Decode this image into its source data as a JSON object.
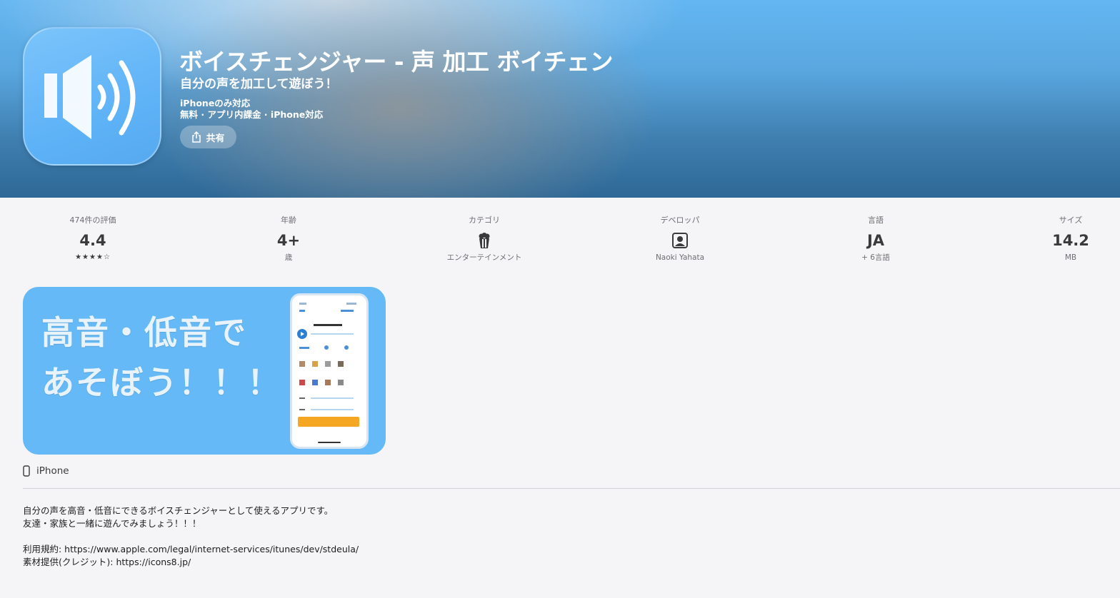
{
  "app": {
    "title": "ボイスチェンジャー - 声 加工 ボイチェン",
    "subtitle": "自分の声を加工して遊ぼう！",
    "compat": "iPhoneのみ対応",
    "price_info": "無料 · アプリ内課金 · iPhone対応",
    "share_label": "共有",
    "icon": "speaker-icon",
    "brand_color": "#5fb3f7"
  },
  "stats": [
    {
      "label": "474件の評価",
      "value": "4.4",
      "sub": "★★★★☆",
      "rating": 4.4
    },
    {
      "label": "年齢",
      "value": "4+",
      "sub": "歳"
    },
    {
      "label": "カテゴリ",
      "icon": "popcorn-icon",
      "sub": "エンターテインメント"
    },
    {
      "label": "デベロッパ",
      "icon": "developer-icon",
      "sub": "Naoki Yahata"
    },
    {
      "label": "言語",
      "value": "JA",
      "sub": "+ 6言語"
    },
    {
      "label": "サイズ",
      "value": "14.2",
      "sub": "MB"
    }
  ],
  "screenshot": {
    "line1": "高音・低音で",
    "line2": "あそぼう！！！"
  },
  "device": {
    "label": "iPhone",
    "icon": "iphone-icon"
  },
  "description": {
    "lines": [
      "自分の声を高音・低音にできるボイスチェンジャーとして使えるアプリです。",
      "友達・家族と一緒に遊んでみましょう！！！",
      "",
      "利用規約: https://www.apple.com/legal/internet-services/itunes/dev/stdeula/",
      "素材提供(クレジット): https://icons8.jp/"
    ]
  }
}
